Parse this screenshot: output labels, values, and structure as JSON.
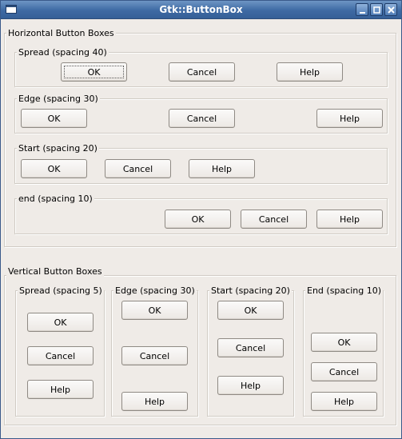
{
  "window": {
    "title": "Gtk::ButtonBox"
  },
  "horizontal": {
    "title": "Horizontal Button Boxes",
    "boxes": [
      {
        "label": "Spread (spacing 40)",
        "buttons": [
          "OK",
          "Cancel",
          "Help"
        ]
      },
      {
        "label": "Edge (spacing 30)",
        "buttons": [
          "OK",
          "Cancel",
          "Help"
        ]
      },
      {
        "label": "Start (spacing 20)",
        "buttons": [
          "OK",
          "Cancel",
          "Help"
        ]
      },
      {
        "label": "end (spacing 10)",
        "buttons": [
          "OK",
          "Cancel",
          "Help"
        ]
      }
    ]
  },
  "vertical": {
    "title": "Vertical Button Boxes",
    "boxes": [
      {
        "label": "Spread (spacing 5)",
        "buttons": [
          "OK",
          "Cancel",
          "Help"
        ]
      },
      {
        "label": "Edge (spacing 30)",
        "buttons": [
          "OK",
          "Cancel",
          "Help"
        ]
      },
      {
        "label": "Start (spacing 20)",
        "buttons": [
          "OK",
          "Cancel",
          "Help"
        ]
      },
      {
        "label": "End (spacing 10)",
        "buttons": [
          "OK",
          "Cancel",
          "Help"
        ]
      }
    ]
  },
  "icons": {
    "window": "window-icon",
    "minimize": "minimize-icon",
    "maximize": "maximize-icon",
    "close": "close-icon"
  },
  "colors": {
    "titlebar": "#3e6aa3",
    "window_bg": "#efebe7"
  }
}
